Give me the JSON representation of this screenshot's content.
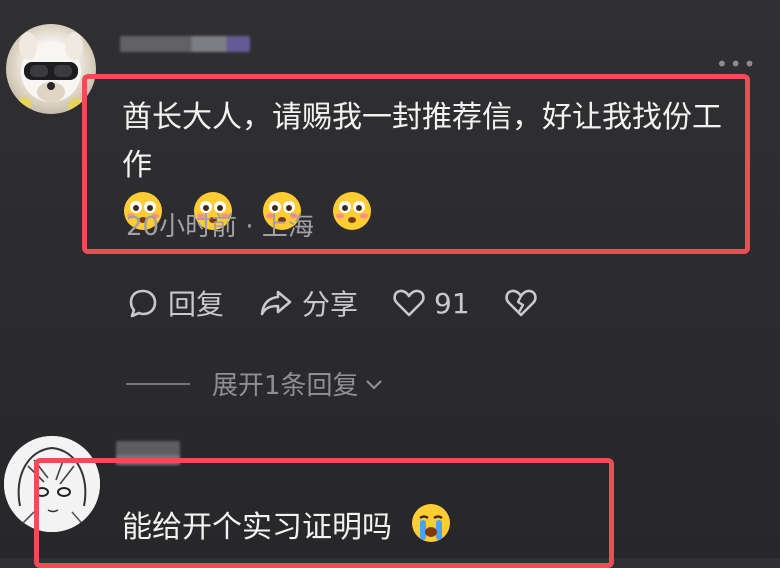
{
  "comments": [
    {
      "text": "酋长大人，请赐我一封推荐信，好让我找份工作",
      "emoji": [
        "flushed-face",
        "flushed-face",
        "flushed-face",
        "flushed-face"
      ],
      "time_location": "20小时前 · 上海",
      "actions": {
        "reply_label": "回复",
        "share_label": "分享",
        "like_count": "91"
      },
      "expand_replies_label": "展开1条回复"
    },
    {
      "text": "能给开个实习证明吗",
      "emoji": [
        "crying-face"
      ]
    }
  ],
  "colors": {
    "background": "#2b2b2e",
    "highlight_border": "#ef4c58",
    "text_primary": "#f2f2f2",
    "text_secondary": "#a0a0a5"
  }
}
